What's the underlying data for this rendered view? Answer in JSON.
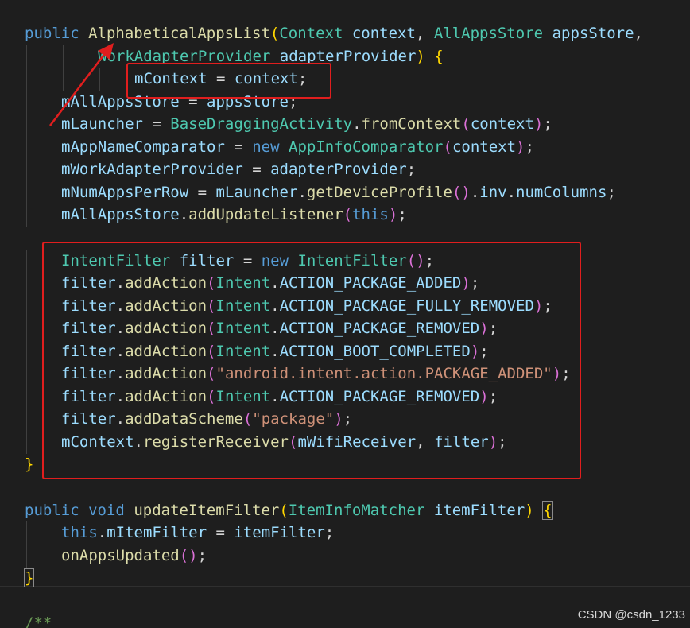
{
  "code": {
    "lines": [
      {
        "indent": 0,
        "tokens": [
          {
            "t": "public",
            "c": "k"
          },
          {
            "t": " ",
            "c": "p"
          },
          {
            "t": "AlphabeticalAppsList",
            "c": "f"
          },
          {
            "t": "(",
            "c": "b1"
          },
          {
            "t": "Context",
            "c": "t"
          },
          {
            "t": " ",
            "c": "p"
          },
          {
            "t": "context",
            "c": "v"
          },
          {
            "t": ", ",
            "c": "p"
          },
          {
            "t": "AllAppsStore",
            "c": "t"
          },
          {
            "t": " ",
            "c": "p"
          },
          {
            "t": "appsStore",
            "c": "v"
          },
          {
            "t": ",",
            "c": "p"
          }
        ]
      },
      {
        "indent": 2,
        "tokens": [
          {
            "t": "WorkAdapterProvider",
            "c": "t"
          },
          {
            "t": " ",
            "c": "p"
          },
          {
            "t": "adapterProvider",
            "c": "v"
          },
          {
            "t": ")",
            "c": "b1"
          },
          {
            "t": " ",
            "c": "p"
          },
          {
            "t": "{",
            "c": "b1"
          }
        ]
      },
      {
        "indent": 3,
        "tokens": [
          {
            "t": "mContext",
            "c": "v"
          },
          {
            "t": " = ",
            "c": "p"
          },
          {
            "t": "context",
            "c": "v"
          },
          {
            "t": ";",
            "c": "p"
          }
        ]
      },
      {
        "indent": 1,
        "tokens": [
          {
            "t": "mAllAppsStore",
            "c": "v"
          },
          {
            "t": " = ",
            "c": "p"
          },
          {
            "t": "appsStore",
            "c": "v"
          },
          {
            "t": ";",
            "c": "p"
          }
        ]
      },
      {
        "indent": 1,
        "tokens": [
          {
            "t": "mLauncher",
            "c": "v"
          },
          {
            "t": " = ",
            "c": "p"
          },
          {
            "t": "BaseDraggingActivity",
            "c": "t"
          },
          {
            "t": ".",
            "c": "p"
          },
          {
            "t": "fromContext",
            "c": "f"
          },
          {
            "t": "(",
            "c": "b2"
          },
          {
            "t": "context",
            "c": "v"
          },
          {
            "t": ")",
            "c": "b2"
          },
          {
            "t": ";",
            "c": "p"
          }
        ]
      },
      {
        "indent": 1,
        "tokens": [
          {
            "t": "mAppNameComparator",
            "c": "v"
          },
          {
            "t": " = ",
            "c": "p"
          },
          {
            "t": "new",
            "c": "k"
          },
          {
            "t": " ",
            "c": "p"
          },
          {
            "t": "AppInfoComparator",
            "c": "t"
          },
          {
            "t": "(",
            "c": "b2"
          },
          {
            "t": "context",
            "c": "v"
          },
          {
            "t": ")",
            "c": "b2"
          },
          {
            "t": ";",
            "c": "p"
          }
        ]
      },
      {
        "indent": 1,
        "tokens": [
          {
            "t": "mWorkAdapterProvider",
            "c": "v"
          },
          {
            "t": " = ",
            "c": "p"
          },
          {
            "t": "adapterProvider",
            "c": "v"
          },
          {
            "t": ";",
            "c": "p"
          }
        ]
      },
      {
        "indent": 1,
        "tokens": [
          {
            "t": "mNumAppsPerRow",
            "c": "v"
          },
          {
            "t": " = ",
            "c": "p"
          },
          {
            "t": "mLauncher",
            "c": "v"
          },
          {
            "t": ".",
            "c": "p"
          },
          {
            "t": "getDeviceProfile",
            "c": "f"
          },
          {
            "t": "()",
            "c": "b2"
          },
          {
            "t": ".",
            "c": "p"
          },
          {
            "t": "inv",
            "c": "v"
          },
          {
            "t": ".",
            "c": "p"
          },
          {
            "t": "numColumns",
            "c": "v"
          },
          {
            "t": ";",
            "c": "p"
          }
        ]
      },
      {
        "indent": 1,
        "tokens": [
          {
            "t": "mAllAppsStore",
            "c": "v"
          },
          {
            "t": ".",
            "c": "p"
          },
          {
            "t": "addUpdateListener",
            "c": "f"
          },
          {
            "t": "(",
            "c": "b2"
          },
          {
            "t": "this",
            "c": "k"
          },
          {
            "t": ")",
            "c": "b2"
          },
          {
            "t": ";",
            "c": "p"
          }
        ]
      },
      {
        "indent": 0,
        "tokens": []
      },
      {
        "indent": 1,
        "tokens": [
          {
            "t": "IntentFilter",
            "c": "t"
          },
          {
            "t": " ",
            "c": "p"
          },
          {
            "t": "filter",
            "c": "v"
          },
          {
            "t": " = ",
            "c": "p"
          },
          {
            "t": "new",
            "c": "k"
          },
          {
            "t": " ",
            "c": "p"
          },
          {
            "t": "IntentFilter",
            "c": "t"
          },
          {
            "t": "()",
            "c": "b2"
          },
          {
            "t": ";",
            "c": "p"
          }
        ]
      },
      {
        "indent": 1,
        "tokens": [
          {
            "t": "filter",
            "c": "v"
          },
          {
            "t": ".",
            "c": "p"
          },
          {
            "t": "addAction",
            "c": "f"
          },
          {
            "t": "(",
            "c": "b2"
          },
          {
            "t": "Intent",
            "c": "t"
          },
          {
            "t": ".",
            "c": "p"
          },
          {
            "t": "ACTION_PACKAGE_ADDED",
            "c": "v"
          },
          {
            "t": ")",
            "c": "b2"
          },
          {
            "t": ";",
            "c": "p"
          }
        ]
      },
      {
        "indent": 1,
        "tokens": [
          {
            "t": "filter",
            "c": "v"
          },
          {
            "t": ".",
            "c": "p"
          },
          {
            "t": "addAction",
            "c": "f"
          },
          {
            "t": "(",
            "c": "b2"
          },
          {
            "t": "Intent",
            "c": "t"
          },
          {
            "t": ".",
            "c": "p"
          },
          {
            "t": "ACTION_PACKAGE_FULLY_REMOVED",
            "c": "v"
          },
          {
            "t": ")",
            "c": "b2"
          },
          {
            "t": ";",
            "c": "p"
          }
        ]
      },
      {
        "indent": 1,
        "tokens": [
          {
            "t": "filter",
            "c": "v"
          },
          {
            "t": ".",
            "c": "p"
          },
          {
            "t": "addAction",
            "c": "f"
          },
          {
            "t": "(",
            "c": "b2"
          },
          {
            "t": "Intent",
            "c": "t"
          },
          {
            "t": ".",
            "c": "p"
          },
          {
            "t": "ACTION_PACKAGE_REMOVED",
            "c": "v"
          },
          {
            "t": ")",
            "c": "b2"
          },
          {
            "t": ";",
            "c": "p"
          }
        ]
      },
      {
        "indent": 1,
        "tokens": [
          {
            "t": "filter",
            "c": "v"
          },
          {
            "t": ".",
            "c": "p"
          },
          {
            "t": "addAction",
            "c": "f"
          },
          {
            "t": "(",
            "c": "b2"
          },
          {
            "t": "Intent",
            "c": "t"
          },
          {
            "t": ".",
            "c": "p"
          },
          {
            "t": "ACTION_BOOT_COMPLETED",
            "c": "v"
          },
          {
            "t": ")",
            "c": "b2"
          },
          {
            "t": ";",
            "c": "p"
          }
        ]
      },
      {
        "indent": 1,
        "tokens": [
          {
            "t": "filter",
            "c": "v"
          },
          {
            "t": ".",
            "c": "p"
          },
          {
            "t": "addAction",
            "c": "f"
          },
          {
            "t": "(",
            "c": "b2"
          },
          {
            "t": "\"android.intent.action.PACKAGE_ADDED\"",
            "c": "s"
          },
          {
            "t": ")",
            "c": "b2"
          },
          {
            "t": ";",
            "c": "p"
          }
        ]
      },
      {
        "indent": 1,
        "tokens": [
          {
            "t": "filter",
            "c": "v"
          },
          {
            "t": ".",
            "c": "p"
          },
          {
            "t": "addAction",
            "c": "f"
          },
          {
            "t": "(",
            "c": "b2"
          },
          {
            "t": "Intent",
            "c": "t"
          },
          {
            "t": ".",
            "c": "p"
          },
          {
            "t": "ACTION_PACKAGE_REMOVED",
            "c": "v"
          },
          {
            "t": ")",
            "c": "b2"
          },
          {
            "t": ";",
            "c": "p"
          }
        ]
      },
      {
        "indent": 1,
        "tokens": [
          {
            "t": "filter",
            "c": "v"
          },
          {
            "t": ".",
            "c": "p"
          },
          {
            "t": "addDataScheme",
            "c": "f"
          },
          {
            "t": "(",
            "c": "b2"
          },
          {
            "t": "\"package\"",
            "c": "s"
          },
          {
            "t": ")",
            "c": "b2"
          },
          {
            "t": ";",
            "c": "p"
          }
        ]
      },
      {
        "indent": 1,
        "tokens": [
          {
            "t": "mContext",
            "c": "v"
          },
          {
            "t": ".",
            "c": "p"
          },
          {
            "t": "registerReceiver",
            "c": "f"
          },
          {
            "t": "(",
            "c": "b2"
          },
          {
            "t": "mWifiReceiver",
            "c": "v"
          },
          {
            "t": ", ",
            "c": "p"
          },
          {
            "t": "filter",
            "c": "v"
          },
          {
            "t": ")",
            "c": "b2"
          },
          {
            "t": ";",
            "c": "p"
          }
        ]
      },
      {
        "indent": 0,
        "tokens": [
          {
            "t": "}",
            "c": "b1"
          }
        ]
      },
      {
        "indent": 0,
        "tokens": []
      },
      {
        "indent": 0,
        "tokens": [
          {
            "t": "public",
            "c": "k"
          },
          {
            "t": " ",
            "c": "p"
          },
          {
            "t": "void",
            "c": "k"
          },
          {
            "t": " ",
            "c": "p"
          },
          {
            "t": "updateItemFilter",
            "c": "f"
          },
          {
            "t": "(",
            "c": "b1"
          },
          {
            "t": "ItemInfoMatcher",
            "c": "t"
          },
          {
            "t": " ",
            "c": "p"
          },
          {
            "t": "itemFilter",
            "c": "v"
          },
          {
            "t": ")",
            "c": "b1"
          },
          {
            "t": " ",
            "c": "p"
          },
          {
            "t": "{",
            "c": "b1",
            "m": true
          }
        ]
      },
      {
        "indent": 1,
        "tokens": [
          {
            "t": "this",
            "c": "k"
          },
          {
            "t": ".",
            "c": "p"
          },
          {
            "t": "mItemFilter",
            "c": "v"
          },
          {
            "t": " = ",
            "c": "p"
          },
          {
            "t": "itemFilter",
            "c": "v"
          },
          {
            "t": ";",
            "c": "p"
          }
        ]
      },
      {
        "indent": 1,
        "tokens": [
          {
            "t": "onAppsUpdated",
            "c": "f"
          },
          {
            "t": "()",
            "c": "b2"
          },
          {
            "t": ";",
            "c": "p"
          }
        ]
      },
      {
        "indent": 0,
        "tokens": [
          {
            "t": "}",
            "c": "b1",
            "m": true
          }
        ]
      },
      {
        "indent": 0,
        "tokens": []
      },
      {
        "indent": 0,
        "tokens": [
          {
            "t": "/**",
            "c": "c"
          }
        ]
      }
    ]
  },
  "watermark": "CSDN @csdn_1233",
  "colors": {
    "background": "#1e1e1e",
    "annotation_red": "#e01e1e",
    "keyword": "#569cd6",
    "type": "#4ec9b0",
    "function": "#dcdcaa",
    "variable": "#9cdcfe",
    "string": "#ce9178",
    "comment": "#6a9955"
  }
}
